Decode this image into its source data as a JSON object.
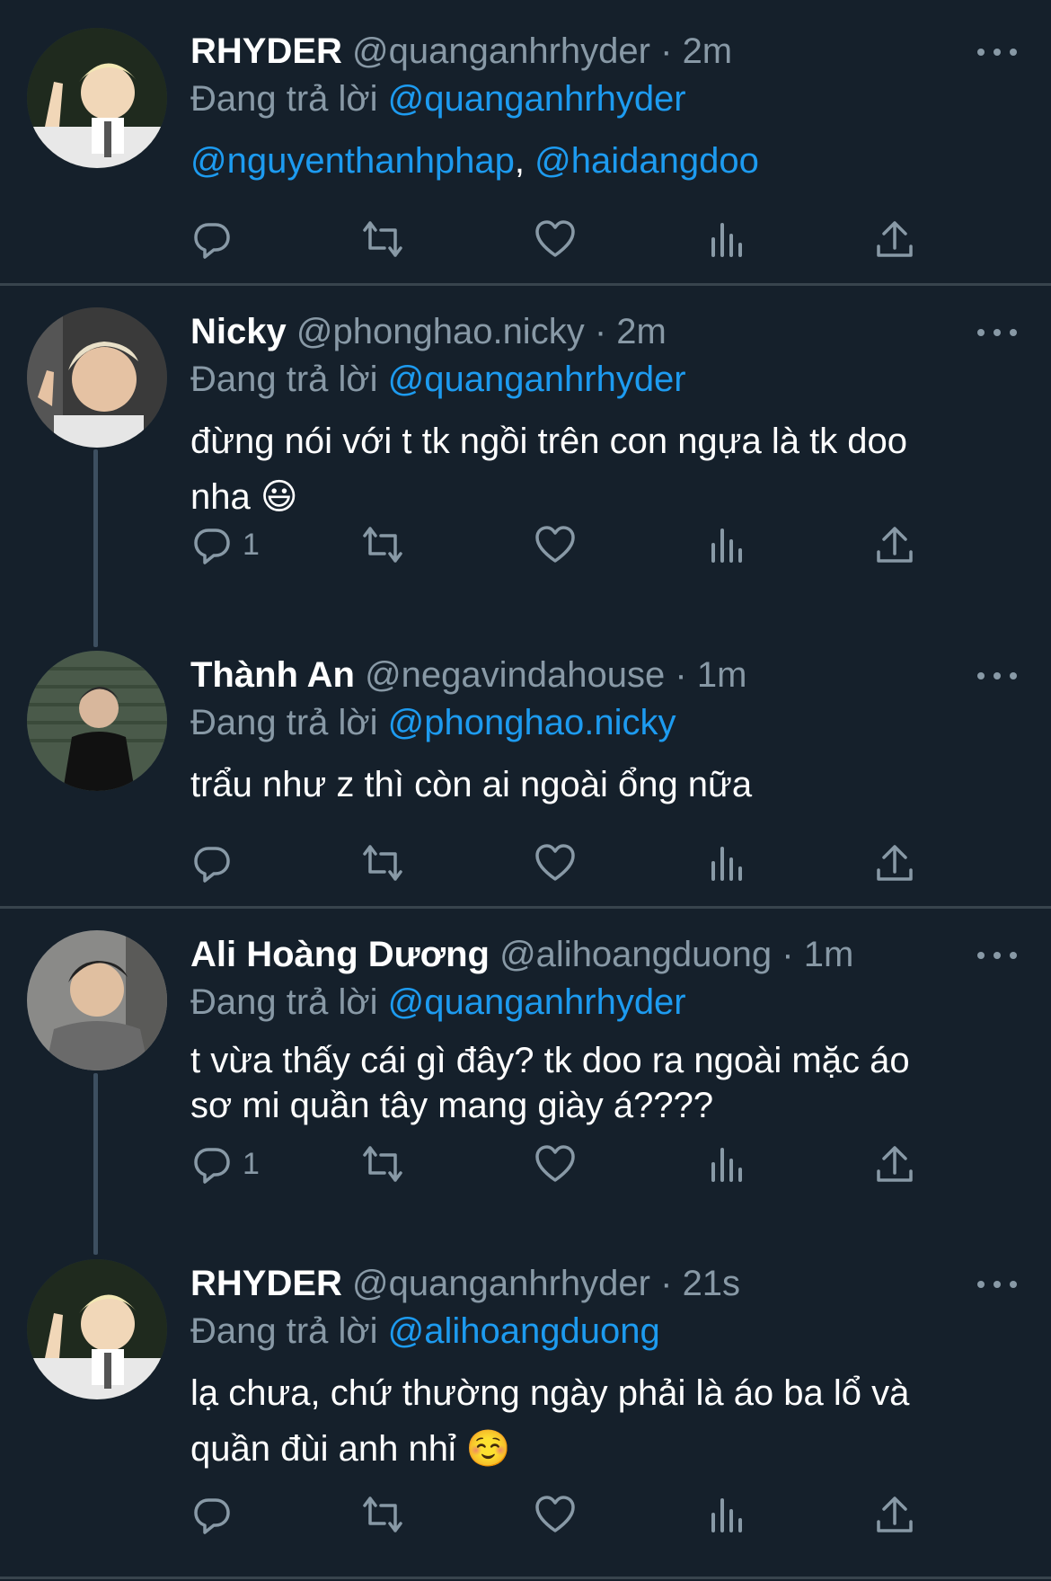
{
  "colors": {
    "background": "#15202b",
    "accent": "#1d9bf0",
    "muted": "#8899a6",
    "divider": "#38444d"
  },
  "tweets": [
    {
      "name": "RHYDER",
      "handle": "@quanganhrhyder",
      "dot": "·",
      "time": "2m",
      "reply_prefix": "Đang trả lời",
      "reply_to": "@quanganhrhyder",
      "text_parts": [
        "@nguyenthanhphap",
        ", ",
        "@haidangdoo"
      ],
      "reply_count": ""
    },
    {
      "name": "Nicky",
      "handle": "@phonghao.nicky",
      "dot": "·",
      "time": "2m",
      "reply_prefix": "Đang trả lời",
      "reply_to": "@quanganhrhyder",
      "text_line1": "đừng nói với t tk ngồi trên con ngựa là tk doo",
      "text_line2": "nha 😃",
      "reply_count": "1"
    },
    {
      "name": "Thành An",
      "handle": "@negavindahouse",
      "dot": "·",
      "time": "1m",
      "reply_prefix": "Đang trả lời",
      "reply_to": "@phonghao.nicky",
      "text_line1": "trẩu như z thì còn ai ngoài ổng nữa",
      "reply_count": ""
    },
    {
      "name": "Ali Hoàng Dương",
      "handle": "@alihoangduong",
      "dot": "·",
      "time": "1m",
      "reply_prefix": "Đang trả lời",
      "reply_to": "@quanganhrhyder",
      "text_line1": "t vừa thấy cái gì đây? tk doo ra ngoài mặc áo",
      "text_line2": "sơ mi quần tây mang giày á????",
      "reply_count": "1"
    },
    {
      "name": "RHYDER",
      "handle": "@quanganhrhyder",
      "dot": "·",
      "time": "21s",
      "reply_prefix": "Đang trả lời",
      "reply_to": "@alihoangduong",
      "text_line1": "lạ chưa, chứ thường ngày phải là áo ba lổ và",
      "text_line2": "quần đùi anh nhỉ ☺️",
      "reply_count": ""
    }
  ],
  "icons": [
    "reply-icon",
    "retweet-icon",
    "like-icon",
    "views-icon",
    "share-icon",
    "more-icon"
  ]
}
